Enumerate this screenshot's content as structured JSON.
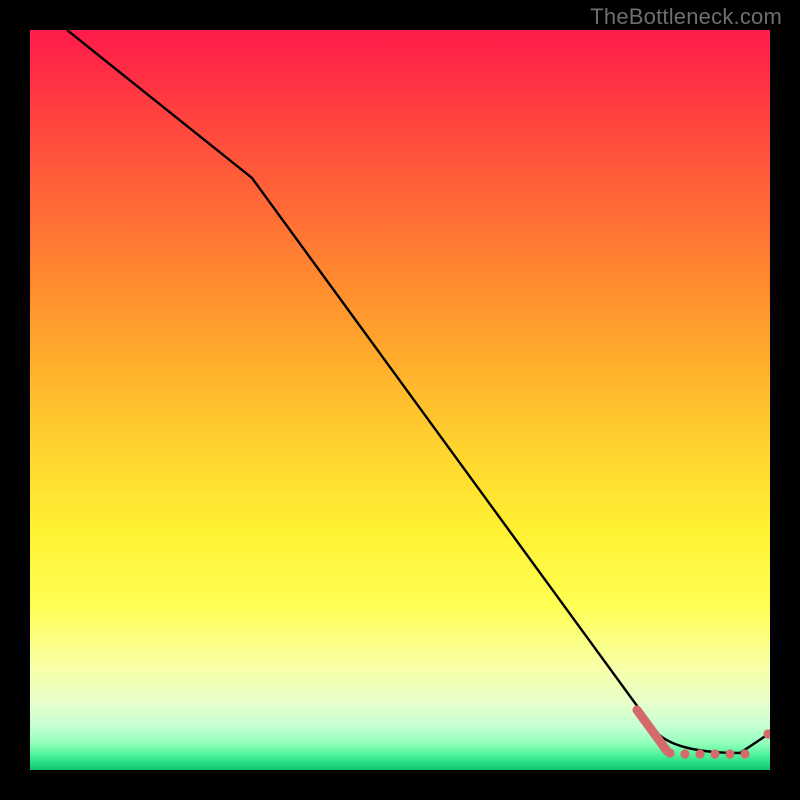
{
  "watermark": "TheBottleneck.com",
  "colors": {
    "background": "#000000",
    "curve": "#000000",
    "accent_dash": "#d46a6a",
    "accent_dot": "#d46a6a"
  },
  "chart_data": {
    "type": "line",
    "title": "",
    "xlabel": "",
    "ylabel": "",
    "xlim": [
      0,
      100
    ],
    "ylim": [
      0,
      100
    ],
    "grid": false,
    "legend": null,
    "series": [
      {
        "name": "main-curve",
        "x": [
          5,
          30,
          84,
          86,
          96,
          100
        ],
        "y": [
          100,
          80,
          6,
          3,
          2,
          5
        ]
      },
      {
        "name": "highlight-dash",
        "x": [
          82,
          86
        ],
        "y": [
          7.5,
          2.5
        ]
      },
      {
        "name": "highlight-dots",
        "x": [
          86.5,
          88.5,
          90.5,
          92.5,
          94.5,
          96.5
        ],
        "y": [
          2.2,
          2.0,
          2.0,
          2.0,
          2.0,
          2.0
        ]
      },
      {
        "name": "end-dot",
        "x": [
          100
        ],
        "y": [
          5
        ]
      }
    ],
    "notes": "Axes unlabeled; values read as relative percentages from gradient plot."
  }
}
